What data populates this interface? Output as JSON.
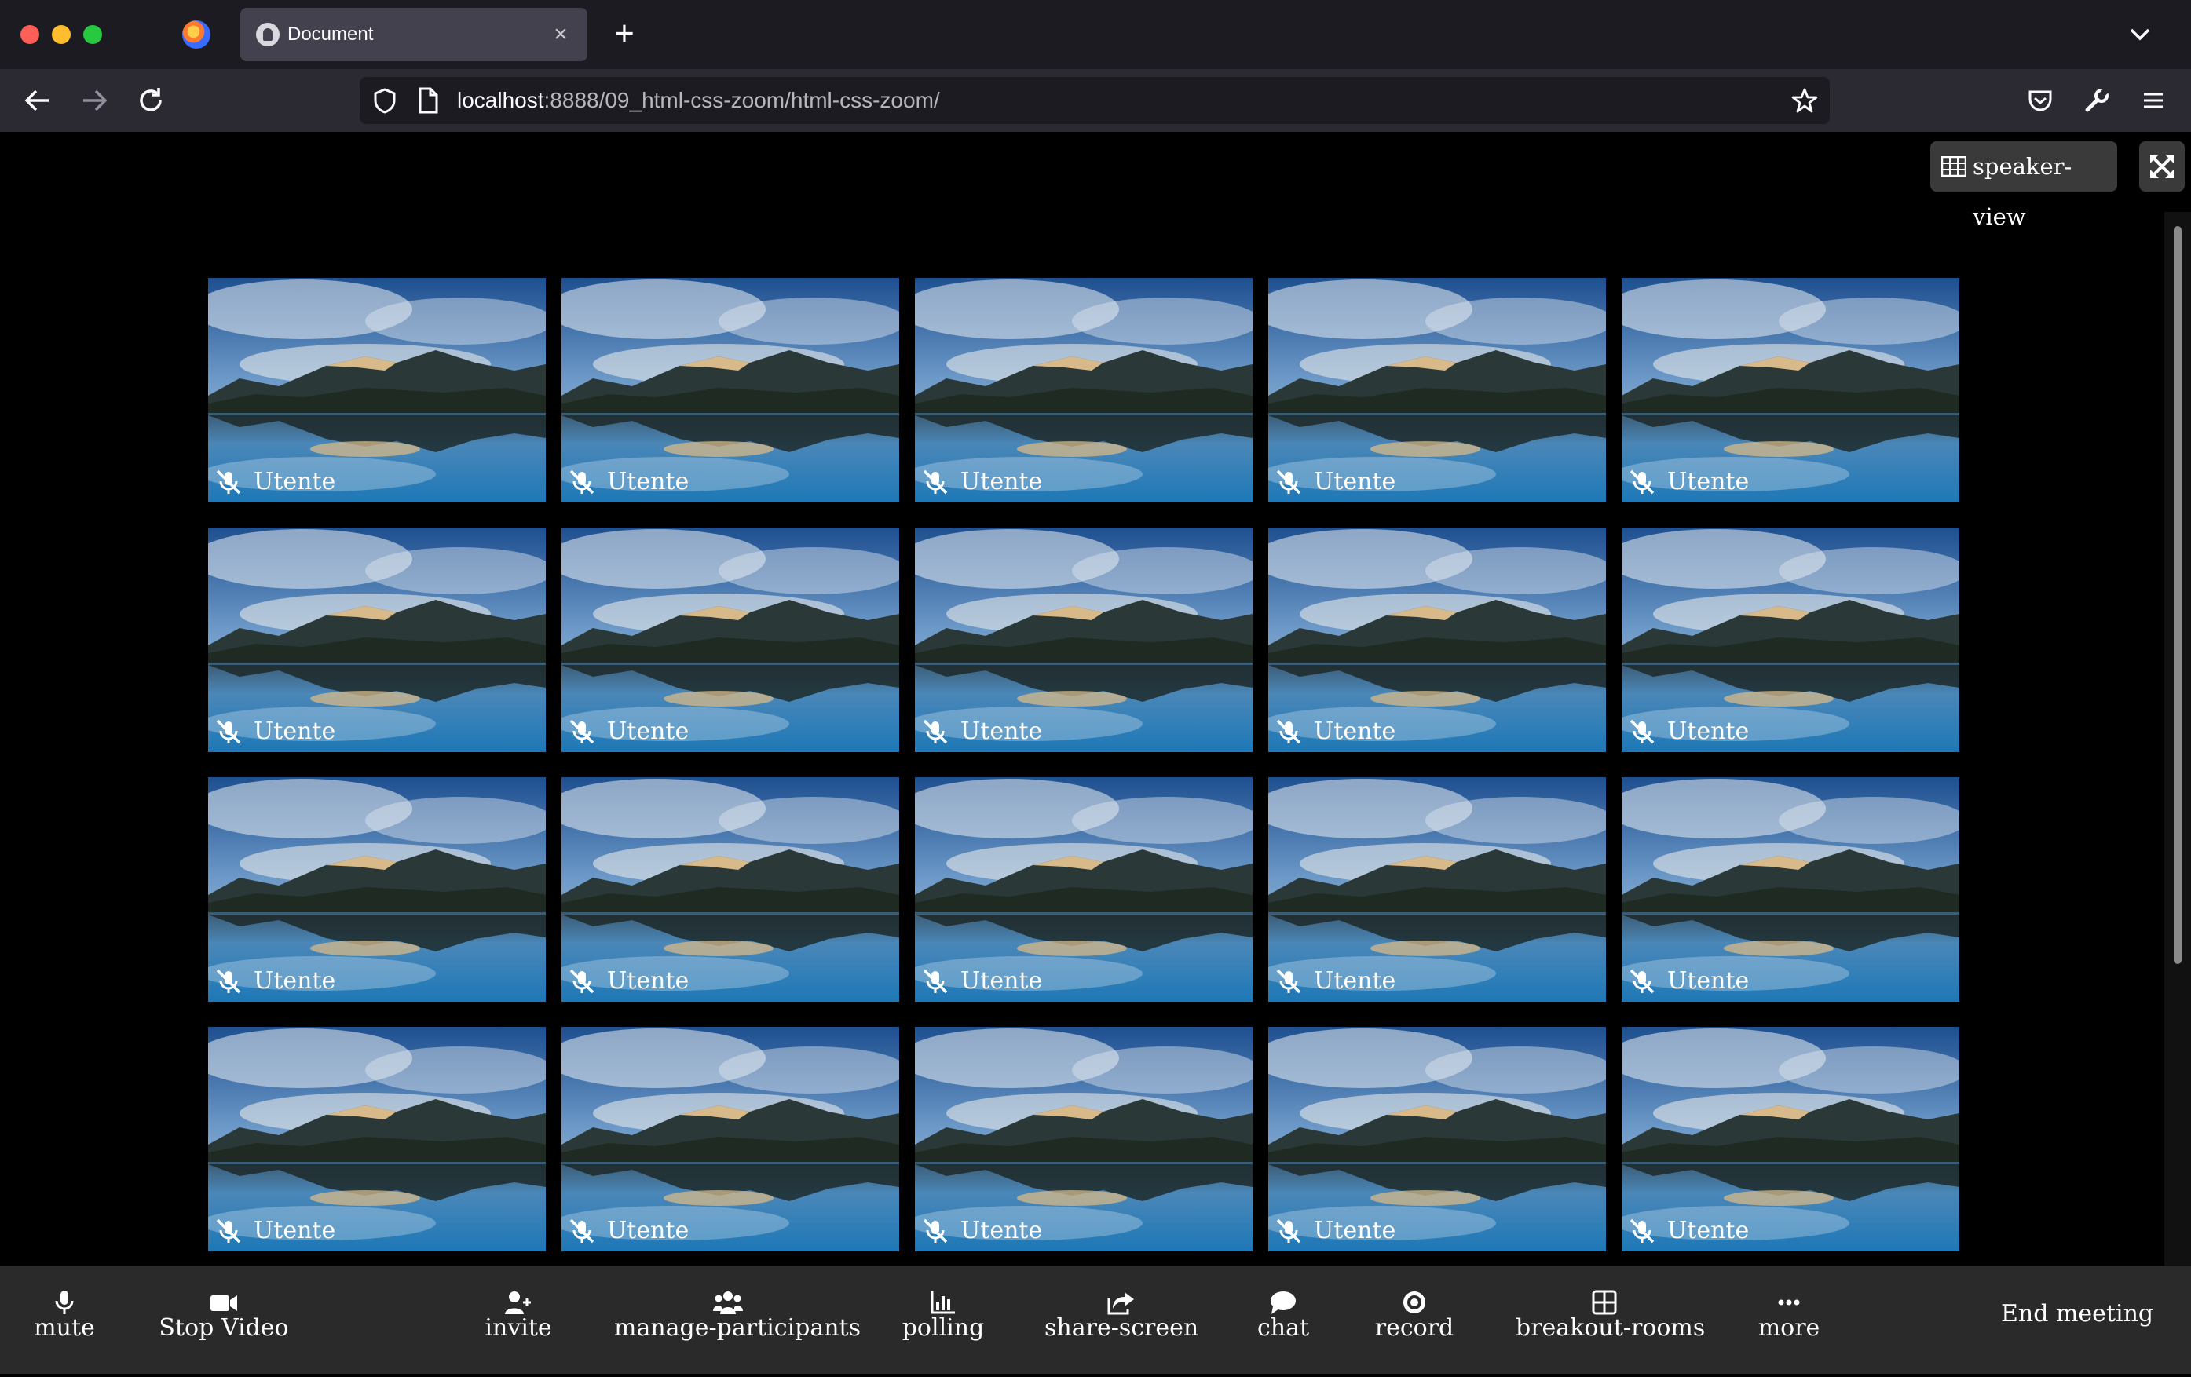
{
  "browser": {
    "tab_title": "Document",
    "new_tab_label": "+",
    "url_host": "localhost",
    "url_rest": ":8888/09_html-css-zoom/html-css-zoom/"
  },
  "top_controls": {
    "speaker_view_label": "speaker-view"
  },
  "participants": [
    {
      "name": "Utente"
    },
    {
      "name": "Utente"
    },
    {
      "name": "Utente"
    },
    {
      "name": "Utente"
    },
    {
      "name": "Utente"
    },
    {
      "name": "Utente"
    },
    {
      "name": "Utente"
    },
    {
      "name": "Utente"
    },
    {
      "name": "Utente"
    },
    {
      "name": "Utente"
    },
    {
      "name": "Utente"
    },
    {
      "name": "Utente"
    },
    {
      "name": "Utente"
    },
    {
      "name": "Utente"
    },
    {
      "name": "Utente"
    },
    {
      "name": "Utente"
    },
    {
      "name": "Utente"
    },
    {
      "name": "Utente"
    },
    {
      "name": "Utente"
    },
    {
      "name": "Utente"
    }
  ],
  "toolbar": {
    "buttons": [
      {
        "label": "mute",
        "icon": "microphone-icon"
      },
      {
        "label": "Stop Video",
        "icon": "video-camera-icon"
      },
      {
        "label": "invite",
        "icon": "user-plus-icon"
      },
      {
        "label": "manage-participants",
        "icon": "users-icon"
      },
      {
        "label": "polling",
        "icon": "bar-chart-icon"
      },
      {
        "label": "share-screen",
        "icon": "share-icon"
      },
      {
        "label": "chat",
        "icon": "chat-bubble-icon"
      },
      {
        "label": "record",
        "icon": "record-icon"
      },
      {
        "label": "breakout-rooms",
        "icon": "grid-icon"
      },
      {
        "label": "more",
        "icon": "ellipsis-icon"
      }
    ],
    "end_meeting_label": "End meeting"
  }
}
